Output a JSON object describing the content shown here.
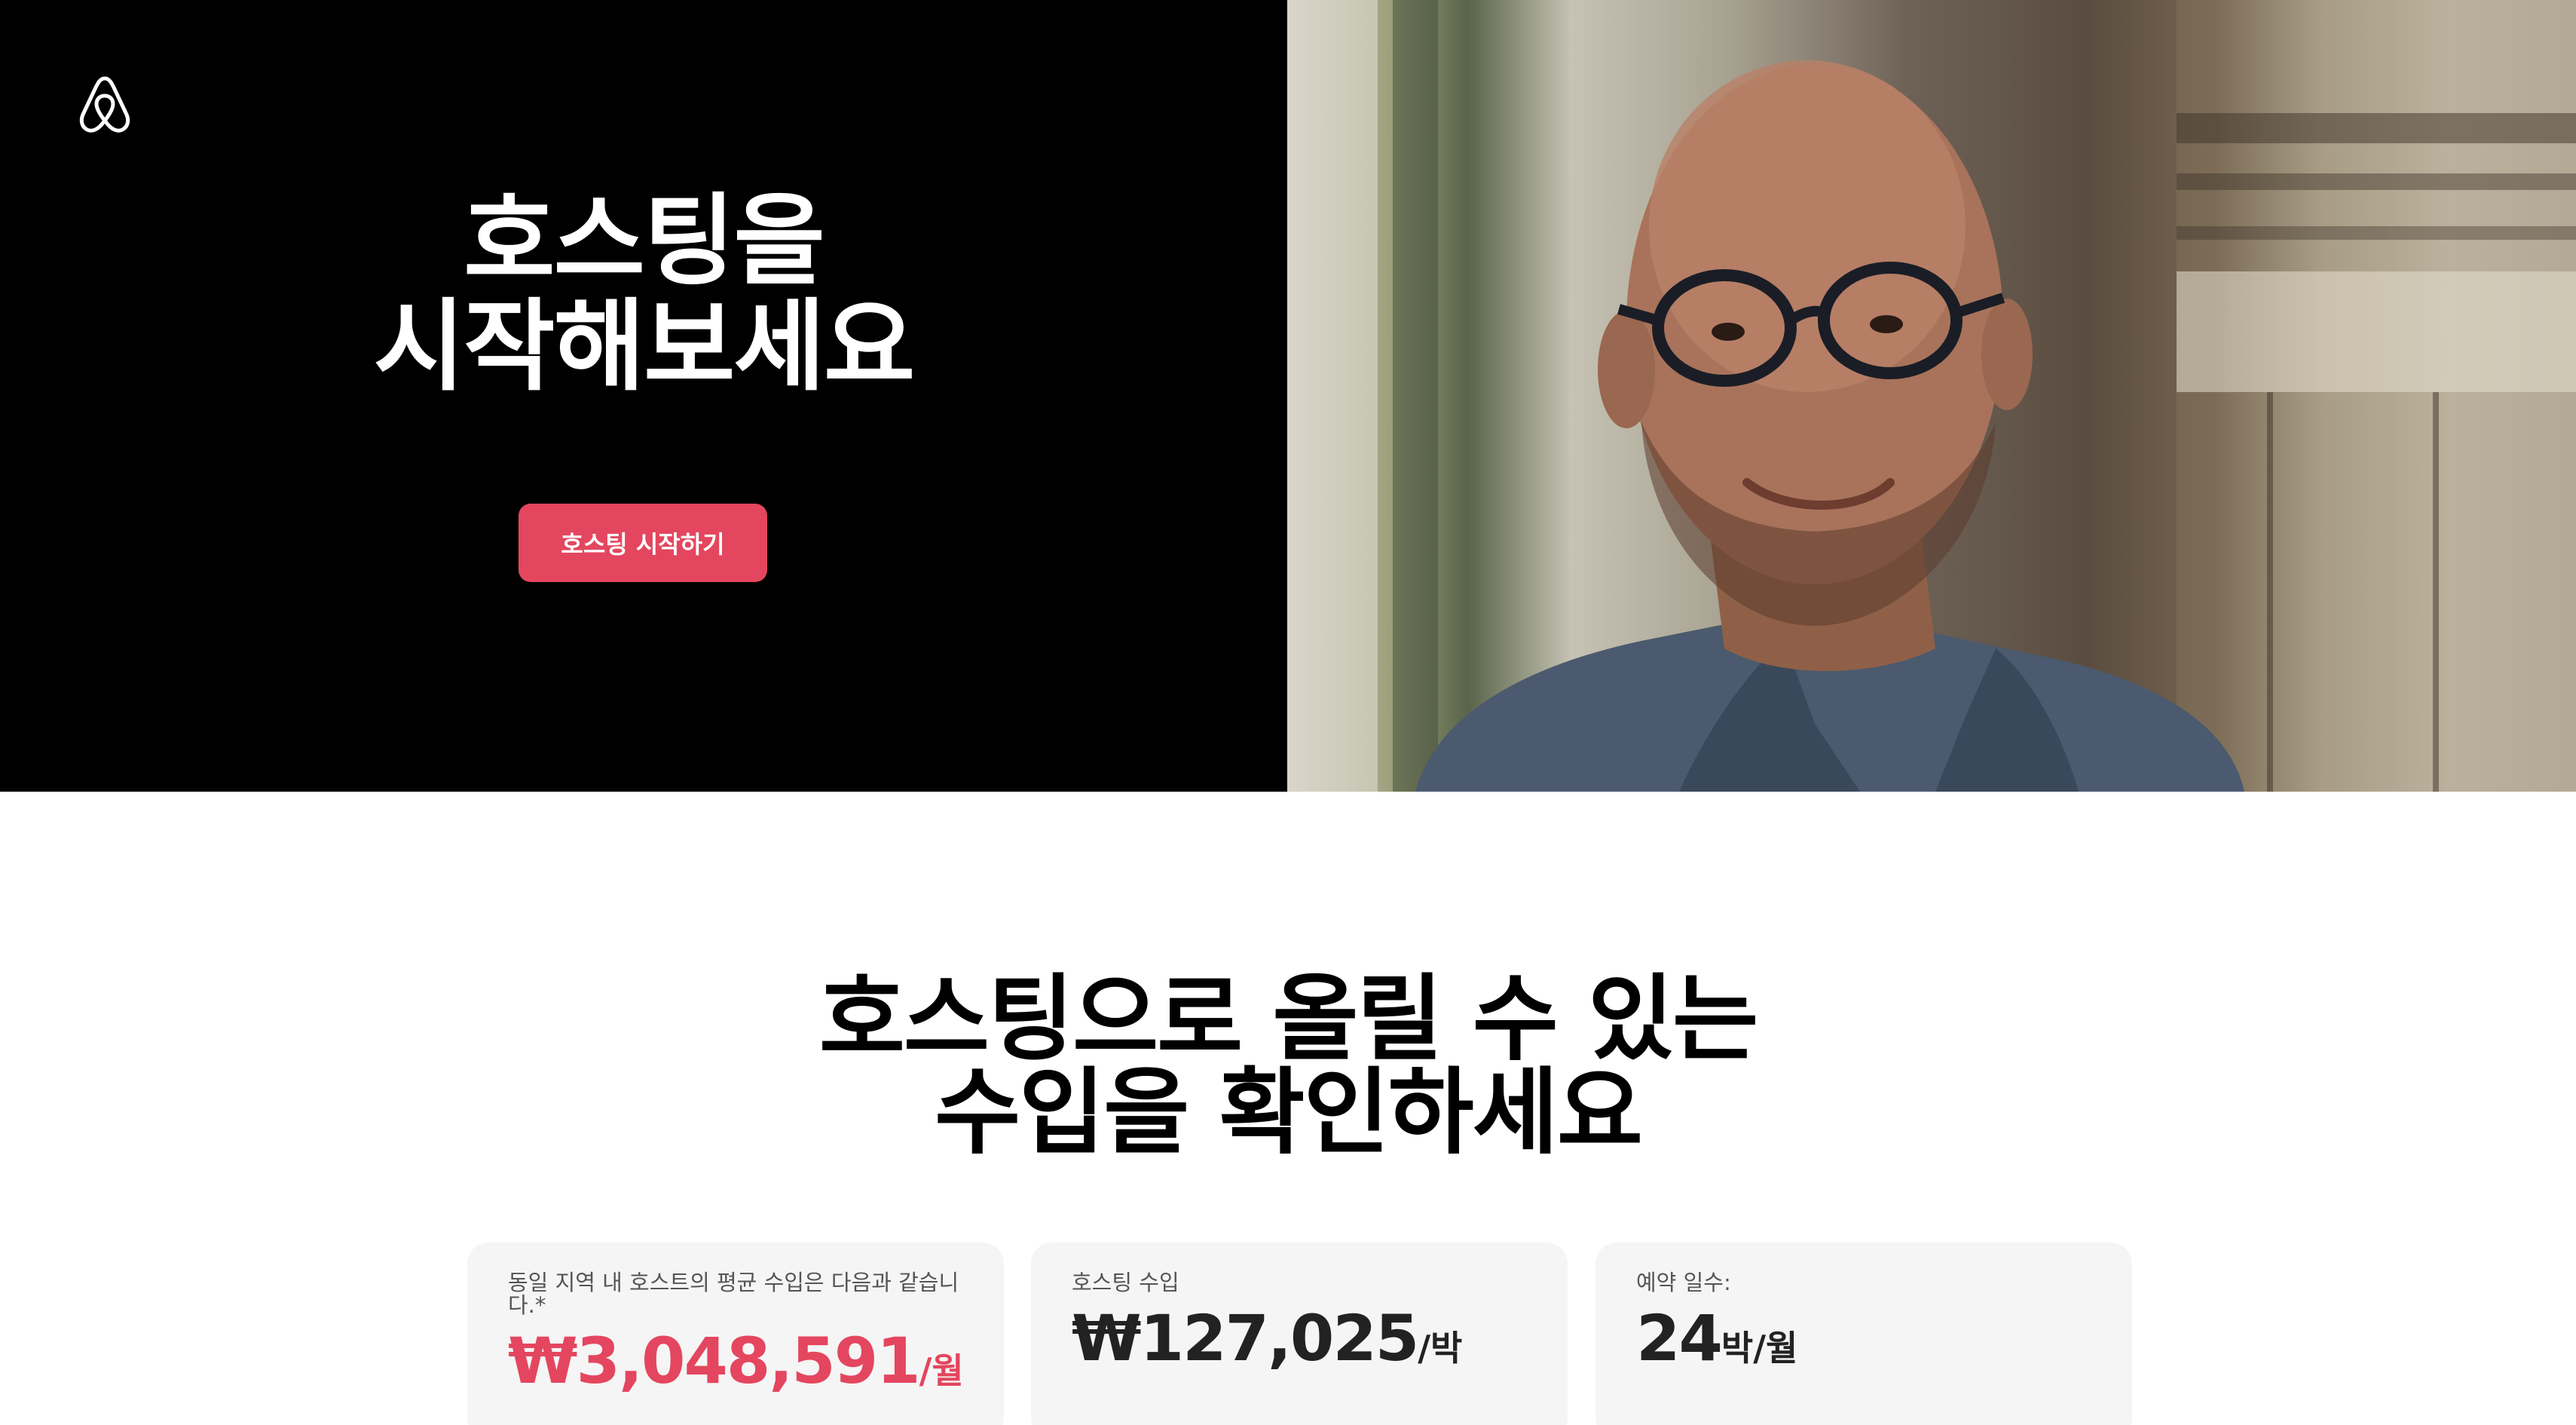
{
  "hero": {
    "title_line1": "호스팅을",
    "title_line2": "시작해보세요",
    "cta_label": "호스팅 시작하기",
    "cta_color": "#e4465f"
  },
  "earnings": {
    "title_line1": "호스팅으로 올릴 수 있는",
    "title_line2": "수입을 확인하세요",
    "cards": [
      {
        "label": "동일 지역 내 호스트의 평균 수입은 다음과 같습니다.*",
        "value": "₩3,048,591",
        "unit": "/월"
      },
      {
        "label": "호스팅 수입",
        "value": "₩127,025",
        "unit": "/박"
      },
      {
        "label": "예약 일수:",
        "value": "24",
        "unit": "박/월"
      }
    ]
  },
  "icons": {
    "logo": "airbnb-logo-icon"
  }
}
